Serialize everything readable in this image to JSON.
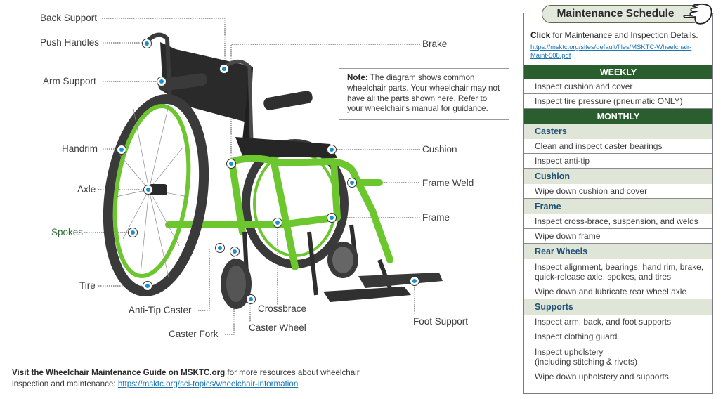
{
  "diagram": {
    "labels": {
      "back_support": "Back Support",
      "push_handles": "Push Handles",
      "arm_support": "Arm Support",
      "handrim": "Handrim",
      "axle": "Axle",
      "spokes": "Spokes",
      "tire": "Tire",
      "anti_tip_caster": "Anti-Tip Caster",
      "caster_fork": "Caster Fork",
      "caster_wheel": "Caster Wheel",
      "crossbrace": "Crossbrace",
      "brake": "Brake",
      "cushion": "Cushion",
      "frame_weld": "Frame Weld",
      "frame": "Frame",
      "foot_support": "Foot Support"
    },
    "colors": {
      "frame_green": "#6cc72e",
      "marker_blue": "#1a8fd0",
      "upholstery": "#2b2b2b"
    },
    "note": {
      "bold": "Note:",
      "text": " The diagram shows common wheelchair parts. Your wheelchair may not have all the parts shown here. Refer to your wheelchair's manual for guidance."
    }
  },
  "footer": {
    "bold": "Visit the Wheelchair Maintenance Guide on MSKTC.org",
    "text": " for more resources about wheelchair inspection and maintenance: ",
    "link": "https://msktc.org/sci-topics/wheelchair-information"
  },
  "schedule": {
    "title": "Maintenance Schedule",
    "icon": "pointing-hand-icon",
    "intro_bold": "Click",
    "intro_text": " for Maintenance and Inspection Details.",
    "link": "https://msktc.org/sites/default/files/MSKTC-Wheelchair-Maint-508.pdf",
    "colors": {
      "section": "#2b5e2f",
      "subsection_bg": "#dfe6d8",
      "subsection_text": "#1e5078"
    },
    "rows": [
      {
        "type": "section",
        "text": "WEEKLY"
      },
      {
        "type": "item",
        "text": "Inspect cushion and cover"
      },
      {
        "type": "item",
        "text": "Inspect tire pressure (pneumatic ONLY)"
      },
      {
        "type": "section",
        "text": "MONTHLY"
      },
      {
        "type": "sub",
        "text": "Casters"
      },
      {
        "type": "item",
        "text": "Clean and inspect caster bearings"
      },
      {
        "type": "item",
        "text": "Inspect anti-tip"
      },
      {
        "type": "sub",
        "text": "Cushion"
      },
      {
        "type": "item",
        "text": "Wipe down cushion and cover"
      },
      {
        "type": "sub",
        "text": "Frame"
      },
      {
        "type": "item",
        "text": "Inspect cross-brace, suspension, and welds"
      },
      {
        "type": "item",
        "text": "Wipe down frame"
      },
      {
        "type": "sub",
        "text": "Rear Wheels"
      },
      {
        "type": "item",
        "text": "Inspect alignment, bearings, hand rim, brake, quick-release axle, spokes, and tires"
      },
      {
        "type": "item",
        "text": "Wipe down and lubricate rear wheel axle"
      },
      {
        "type": "sub",
        "text": "Supports"
      },
      {
        "type": "item",
        "text": "Inspect arm, back, and foot supports"
      },
      {
        "type": "item",
        "text": "Inspect clothing guard"
      },
      {
        "type": "item",
        "text": "Inspect upholstery\n(including stitching & rivets)"
      },
      {
        "type": "item",
        "text": "Wipe down upholstery and supports"
      }
    ]
  }
}
